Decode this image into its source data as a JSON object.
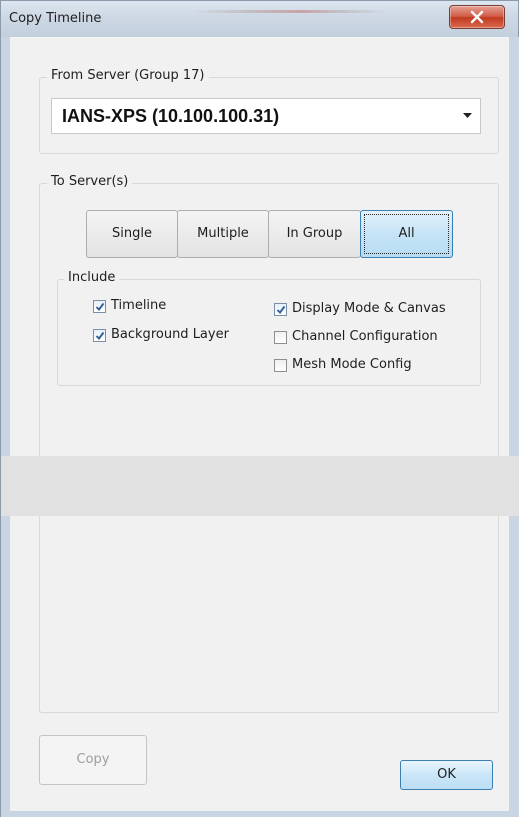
{
  "window": {
    "title": "Copy Timeline"
  },
  "from_server": {
    "group_label": "From Server  (Group 17)",
    "selected": "IANS-XPS  (10.100.100.31)"
  },
  "to_server": {
    "group_label": "To Server(s)",
    "tabs": [
      "Single",
      "Multiple",
      "In Group",
      "All"
    ],
    "active_tab": "All"
  },
  "include": {
    "group_label": "Include",
    "options": [
      {
        "label": "Timeline",
        "checked": true
      },
      {
        "label": "Background Layer",
        "checked": true
      },
      {
        "label": "Display Mode & Canvas",
        "checked": true
      },
      {
        "label": "Channel Configuration",
        "checked": false
      },
      {
        "label": "Mesh Mode Config",
        "checked": false
      }
    ]
  },
  "buttons": {
    "copy": "Copy",
    "ok": "OK"
  }
}
